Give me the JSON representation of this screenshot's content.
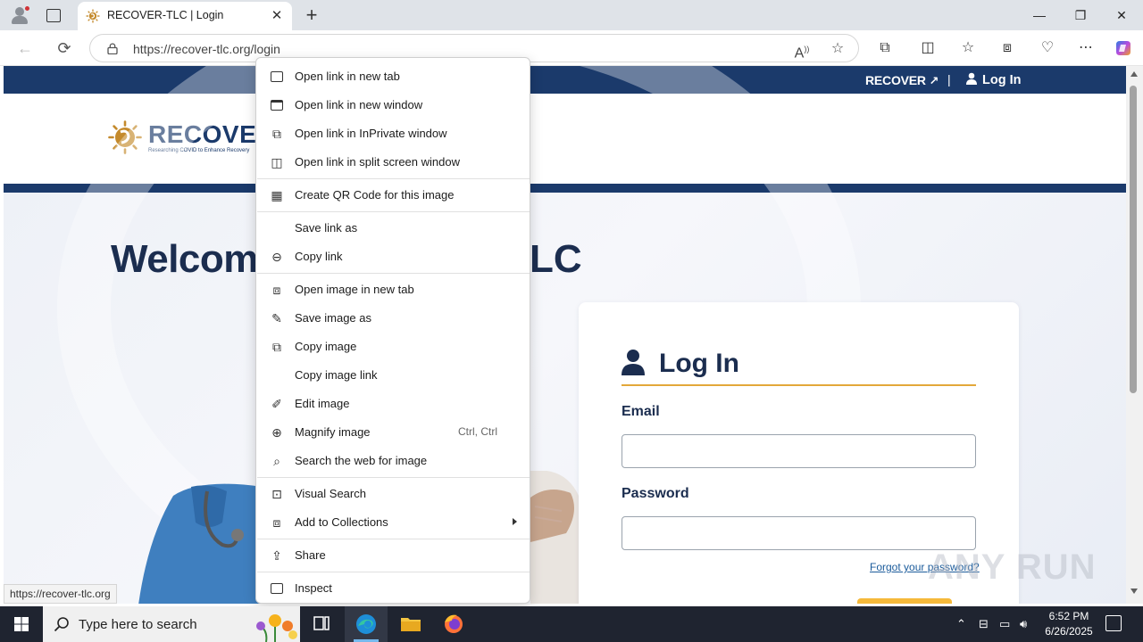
{
  "browser": {
    "tab_title": "RECOVER-TLC | Login",
    "url": "https://recover-tlc.org/login",
    "new_tab_symbol": "+",
    "tab_close_symbol": "✕",
    "window_controls": {
      "minimize": "—",
      "restore": "❐",
      "close": "✕"
    }
  },
  "site": {
    "topbar": {
      "recover_link": "RECOVER",
      "separator": "|",
      "login_link": "Log In"
    },
    "logo": {
      "word": "RECOVER",
      "tagline": "Researching COVID to Enhance Recovery"
    },
    "welcome_visible": "Welcome",
    "welcome_tail": "LC",
    "login_card": {
      "title": "Log In",
      "email_label": "Email",
      "password_label": "Password",
      "forgot_link": "Forgot your password?"
    },
    "accent_color": "#1b3a6b",
    "highlight_color": "#e3a83a"
  },
  "status_url": "https://recover-tlc.org",
  "watermark": "ANY RUN",
  "context_menu": {
    "items": [
      {
        "label": "Open link in new tab",
        "icon": "new-tab-icon"
      },
      {
        "label": "Open link in new window",
        "icon": "new-window-icon"
      },
      {
        "label": "Open link in InPrivate window",
        "icon": "inprivate-icon"
      },
      {
        "label": "Open link in split screen window",
        "icon": "split-screen-icon"
      },
      {
        "label": "Create QR Code for this image",
        "icon": "qr-code-icon"
      },
      {
        "label": "Save link as",
        "icon": ""
      },
      {
        "label": "Copy link",
        "icon": "link-icon"
      },
      {
        "label": "Open image in new tab",
        "icon": "image-new-tab-icon"
      },
      {
        "label": "Save image as",
        "icon": "save-image-icon"
      },
      {
        "label": "Copy image",
        "icon": "copy-image-icon"
      },
      {
        "label": "Copy image link",
        "icon": ""
      },
      {
        "label": "Edit image",
        "icon": "edit-image-icon"
      },
      {
        "label": "Magnify image",
        "icon": "magnify-icon",
        "shortcut": "Ctrl, Ctrl"
      },
      {
        "label": "Search the web for image",
        "icon": "search-web-icon"
      },
      {
        "label": "Visual Search",
        "icon": "visual-search-icon"
      },
      {
        "label": "Add to Collections",
        "icon": "collections-icon",
        "submenu": true
      },
      {
        "label": "Share",
        "icon": "share-icon"
      },
      {
        "label": "Inspect",
        "icon": "inspect-icon"
      }
    ]
  },
  "taskbar": {
    "search_placeholder": "Type here to search",
    "time": "6:52 PM",
    "date": "6/26/2025"
  }
}
